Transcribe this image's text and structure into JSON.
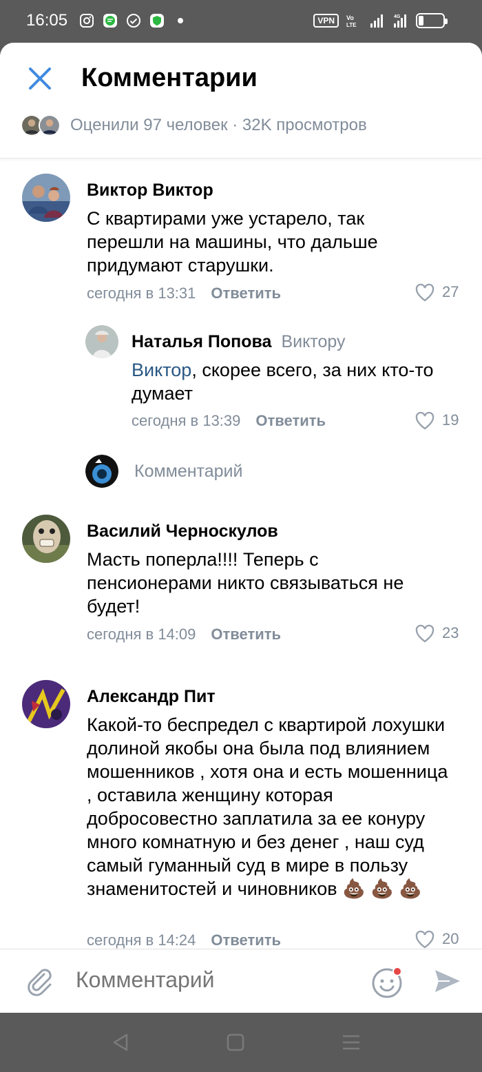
{
  "status_bar": {
    "time": "16:05",
    "vpn_label": "VPN",
    "network": "4G"
  },
  "header": {
    "title": "Комментарии",
    "likes_summary": "Оценили 97 человек · 32K просмотров"
  },
  "comments": [
    {
      "author": "Виктор Виктор",
      "text": "С квартирами уже устарело, так перешли на машины, что дальше придумают старушки.",
      "time": "сегодня в 13:31",
      "reply_label": "Ответить",
      "likes": "27"
    },
    {
      "author": "Наталья Попова",
      "reply_to": "Виктору",
      "mention": "Виктор",
      "text": ", скорее всего, за них кто-то думает",
      "time": "сегодня в 13:39",
      "reply_label": "Ответить",
      "likes": "19"
    },
    {
      "author": "Василий Черноскулов",
      "text": "Масть поперла!!!! Теперь с пенсионерами никто связываться не будет!",
      "time": "сегодня в 14:09",
      "reply_label": "Ответить",
      "likes": "23"
    },
    {
      "author": "Александр Пит",
      "text": "Какой-то беспредел с квартирой лохушки долиной якобы она была под влиянием мошенников , хотя она и есть мошенница , оставила женщину которая добросовестно заплатила за ее конуру много комнатную и без денег , наш суд самый гуманный суд в мире в пользу знаменитостей и чиновников 💩 💩 💩",
      "time": "сегодня в 14:24",
      "reply_label": "Ответить",
      "likes": "20"
    }
  ],
  "thread_reply_placeholder": "Комментарий",
  "composer": {
    "placeholder": "Комментарий"
  },
  "colors": {
    "accent": "#3f8ae0",
    "secondary_text": "#818c99",
    "mention": "#2a5885",
    "system_bar": "#5a5a5a"
  }
}
